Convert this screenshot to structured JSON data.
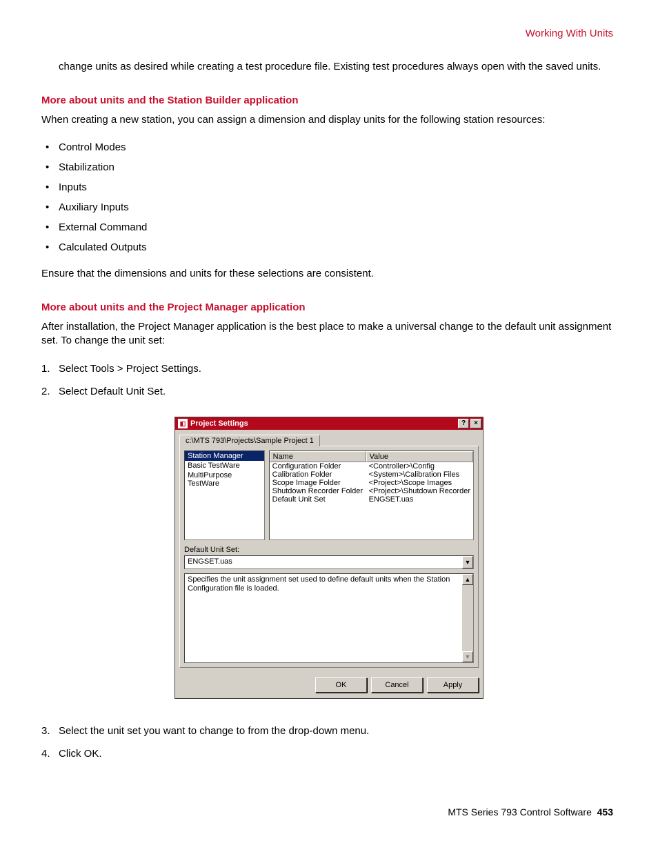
{
  "header": {
    "title": "Working With Units"
  },
  "intro": "change units as desired while creating a test procedure file. Existing test procedures always open with the saved units.",
  "section1": {
    "heading": "More about units and the Station Builder application",
    "lead": "When creating a new station, you can assign a dimension and display units for the following station resources:",
    "bullets": [
      "Control Modes",
      "Stabilization",
      "Inputs",
      "Auxiliary Inputs",
      "External Command",
      "Calculated Outputs"
    ],
    "tail": "Ensure that the dimensions and units for these selections are consistent."
  },
  "section2": {
    "heading": "More about units and the Project Manager application",
    "lead": "After installation, the Project Manager application is the best place to make a universal change to the default unit assignment set. To change the unit set:",
    "steps_a": [
      "Select Tools > Project Settings.",
      "Select Default Unit Set."
    ],
    "steps_b": [
      "Select the unit set you want to change to from the drop-down menu.",
      "Click OK."
    ]
  },
  "dialog": {
    "title": "Project Settings",
    "help_glyph": "?",
    "close_glyph": "×",
    "tab": "c:\\MTS 793\\Projects\\Sample Project 1",
    "list": {
      "items": [
        "Station Manager",
        "Basic TestWare",
        "MultiPurpose TestWare"
      ],
      "selected_index": 0
    },
    "table": {
      "col_name": "Name",
      "col_value": "Value",
      "rows": [
        {
          "name": "Configuration Folder",
          "value": "<Controller>\\Config"
        },
        {
          "name": "Calibration Folder",
          "value": "<System>\\Calibration Files"
        },
        {
          "name": "Scope Image Folder",
          "value": "<Project>\\Scope Images"
        },
        {
          "name": "Shutdown Recorder Folder",
          "value": "<Project>\\Shutdown Recorder"
        },
        {
          "name": "Default Unit Set",
          "value": "ENGSET.uas"
        }
      ]
    },
    "field_label": "Default Unit Set:",
    "dropdown_value": "ENGSET.uas",
    "description": "Specifies the unit assignment set used to define default units when the Station Configuration file is loaded.",
    "buttons": {
      "ok": "OK",
      "cancel": "Cancel",
      "apply": "Apply"
    },
    "glyphs": {
      "down": "▼",
      "up": "▲"
    }
  },
  "footer": {
    "product": "MTS Series 793 Control Software",
    "page": "453"
  }
}
